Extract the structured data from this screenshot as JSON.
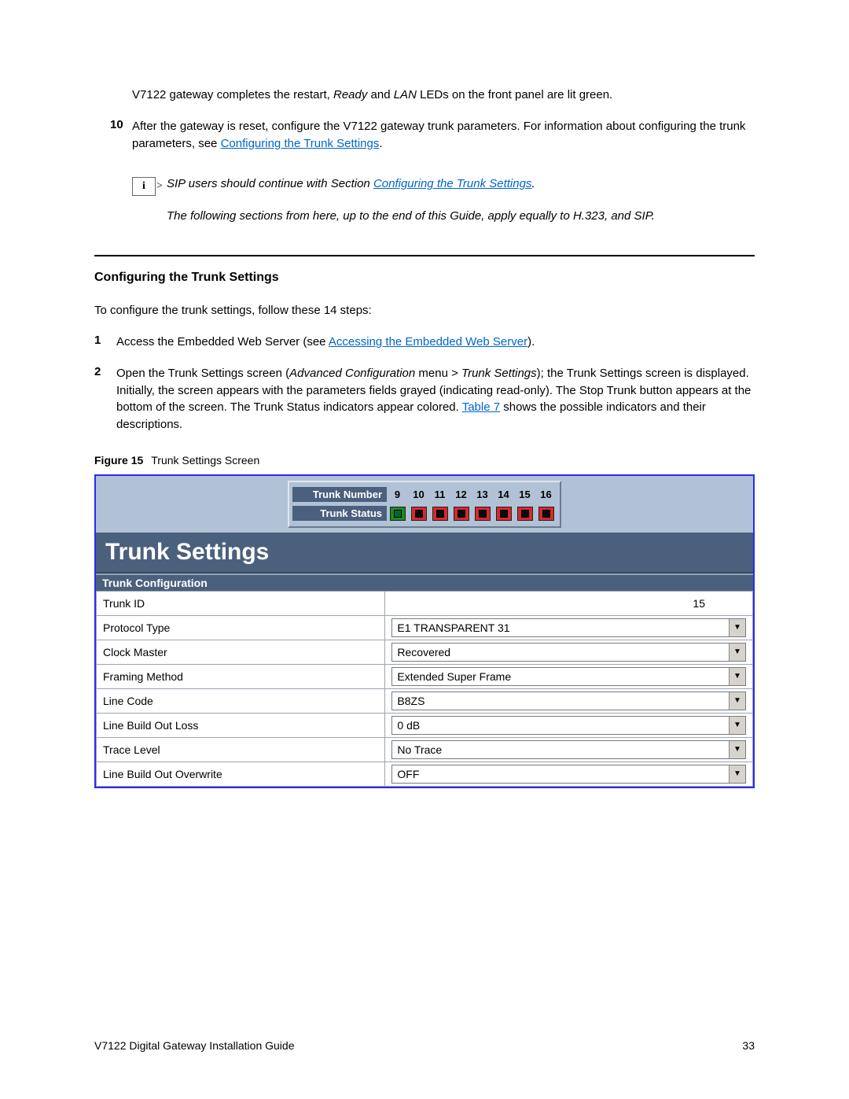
{
  "intro_before_italic": "V7122 gateway completes the restart, ",
  "intro_italic1": "Ready",
  "intro_mid": " and ",
  "intro_italic2": "LAN",
  "intro_after": " LEDs on the front panel are lit green.",
  "step10_num": "10",
  "step10_text_a": "After the gateway is reset, configure the V7122 gateway trunk parameters. For information about configuring the trunk parameters, see ",
  "step10_link": "Configuring the Trunk Settings",
  "step10_text_b": ".",
  "note_line1_a": "SIP users should continue with Section ",
  "note_line1_link": "Configuring the Trunk Settings",
  "note_line1_b": ".",
  "note_line2": "The following sections from here, up to the end of this Guide, apply equally to H.323, and SIP.",
  "section_title": "Configuring the Trunk Settings",
  "cfg_intro": "To configure the trunk settings, follow these 14 steps:",
  "step1_num": "1",
  "step1_a": "Access the Embedded Web Server (see ",
  "step1_link": "Accessing the Embedded Web Server",
  "step1_b": ").",
  "step2_num": "2",
  "step2_a": "Open the Trunk Settings screen (",
  "step2_it1": "Advanced Configuration",
  "step2_b": " menu > ",
  "step2_it2": "Trunk Settings",
  "step2_c": "); the Trunk Settings screen is displayed.",
  "step2_para2_a": "Initially, the screen appears with the parameters fields grayed (indicating read-only). The Stop Trunk button appears at the bottom of the screen. The Trunk Status indicators appear colored.  ",
  "step2_para2_link": "Table 7",
  "step2_para2_b": " shows the possible indicators and their descriptions.",
  "figure_label": "Figure 15",
  "figure_caption": "Trunk Settings Screen",
  "panel": {
    "number_label": "Trunk Number",
    "status_label": "Trunk Status",
    "numbers": [
      "9",
      "10",
      "11",
      "12",
      "13",
      "14",
      "15",
      "16"
    ],
    "statuses": [
      "green",
      "red",
      "red",
      "red",
      "red",
      "red",
      "red",
      "red"
    ]
  },
  "ss_title": "Trunk Settings",
  "ss_subhead": "Trunk Configuration",
  "config_rows": [
    {
      "label": "Trunk ID",
      "value": "15",
      "type": "text-right"
    },
    {
      "label": "Protocol Type",
      "value": "E1 TRANSPARENT 31",
      "type": "select"
    },
    {
      "label": "Clock Master",
      "value": "Recovered",
      "type": "select"
    },
    {
      "label": "Framing Method",
      "value": "Extended Super Frame",
      "type": "select"
    },
    {
      "label": "Line Code",
      "value": "B8ZS",
      "type": "select"
    },
    {
      "label": "Line Build Out Loss",
      "value": "0 dB",
      "type": "select"
    },
    {
      "label": "Trace Level",
      "value": "No Trace",
      "type": "select"
    },
    {
      "label": "Line Build Out Overwrite",
      "value": "OFF",
      "type": "select"
    }
  ],
  "footer_left": "V7122 Digital Gateway Installation Guide",
  "footer_right": "33",
  "info_glyph": "i"
}
